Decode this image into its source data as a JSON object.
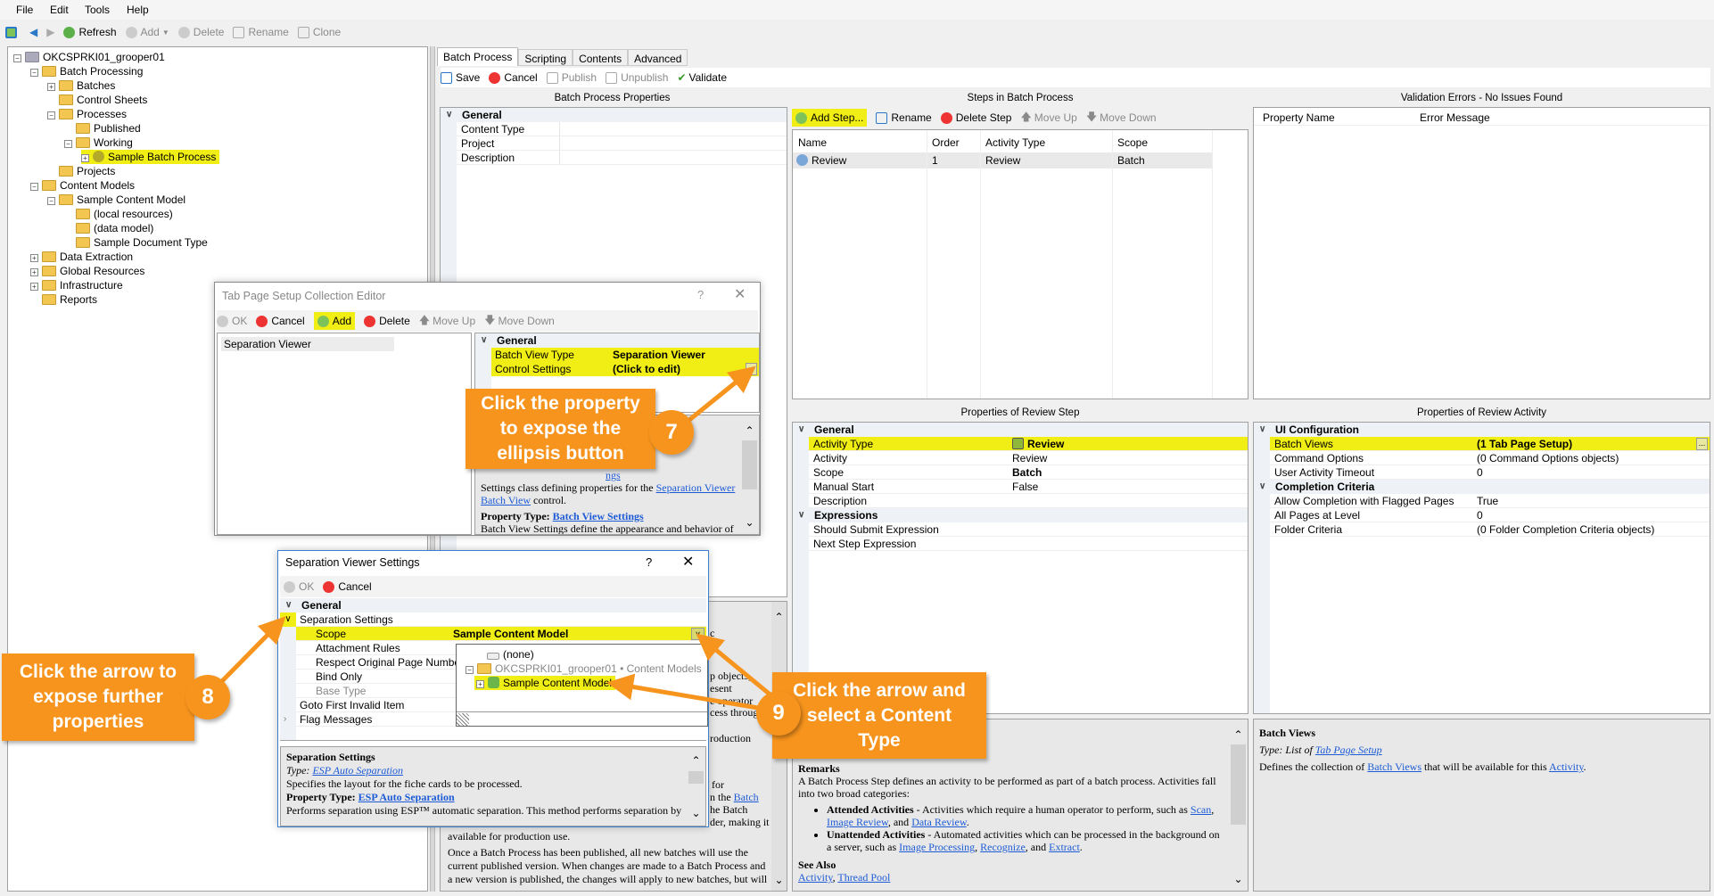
{
  "menu": [
    "File",
    "Edit",
    "Tools",
    "Help"
  ],
  "main_toolbar": {
    "refresh": "Refresh",
    "add": "Add",
    "delete": "Delete",
    "rename": "Rename",
    "clone": "Clone"
  },
  "tree": [
    {
      "label": "OKCSPRKI01_grooper01",
      "level": 0,
      "toggle": "-"
    },
    {
      "label": "Batch Processing",
      "level": 1,
      "toggle": "-"
    },
    {
      "label": "Batches",
      "level": 2,
      "toggle": "+"
    },
    {
      "label": "Control Sheets",
      "level": 2,
      "toggle": ""
    },
    {
      "label": "Processes",
      "level": 2,
      "toggle": "-"
    },
    {
      "label": "Published",
      "level": 3,
      "toggle": ""
    },
    {
      "label": "Working",
      "level": 3,
      "toggle": "-"
    },
    {
      "label": "Sample Batch Process",
      "level": 4,
      "toggle": "+",
      "selected": true
    },
    {
      "label": "Projects",
      "level": 2,
      "toggle": ""
    },
    {
      "label": "Content Models",
      "level": 1,
      "toggle": "-"
    },
    {
      "label": "Sample Content Model",
      "level": 2,
      "toggle": "-"
    },
    {
      "label": "(local resources)",
      "level": 3,
      "toggle": ""
    },
    {
      "label": "(data model)",
      "level": 3,
      "toggle": ""
    },
    {
      "label": "Sample Document Type",
      "level": 3,
      "toggle": ""
    },
    {
      "label": "Data Extraction",
      "level": 1,
      "toggle": "+"
    },
    {
      "label": "Global Resources",
      "level": 1,
      "toggle": "+"
    },
    {
      "label": "Infrastructure",
      "level": 1,
      "toggle": "+"
    },
    {
      "label": "Reports",
      "level": 1,
      "toggle": ""
    }
  ],
  "tabs": [
    "Batch Process",
    "Scripting",
    "Contents",
    "Advanced"
  ],
  "editor_toolbar": {
    "save": "Save",
    "cancel": "Cancel",
    "publish": "Publish",
    "unpublish": "Unpublish",
    "validate": "Validate"
  },
  "batch_props": {
    "title": "Batch Process Properties",
    "group": "General",
    "rows": [
      {
        "name": "Content Type",
        "value": ""
      },
      {
        "name": "Project",
        "value": ""
      },
      {
        "name": "Description",
        "value": ""
      }
    ]
  },
  "steps": {
    "title": "Steps in Batch Process",
    "toolbar": {
      "add": "Add Step...",
      "rename": "Rename",
      "delete": "Delete Step",
      "up": "Move Up",
      "down": "Move Down"
    },
    "columns": [
      "Name",
      "Order",
      "Activity Type",
      "Scope"
    ],
    "rows": [
      {
        "name": "Review",
        "order": "1",
        "type": "Review",
        "scope": "Batch"
      }
    ]
  },
  "validation": {
    "title": "Validation Errors - No Issues Found",
    "columns": [
      "Property Name",
      "Error Message"
    ]
  },
  "step_props": {
    "title": "Properties of Review Step",
    "group1": "General",
    "rows1": [
      {
        "name": "Activity Type",
        "value": "Review"
      },
      {
        "name": "Activity",
        "value": "Review"
      },
      {
        "name": "Scope",
        "value": "Batch"
      },
      {
        "name": "Manual Start",
        "value": "False"
      },
      {
        "name": "Description",
        "value": ""
      }
    ],
    "group2": "Expressions",
    "rows2": [
      {
        "name": "Should Submit Expression",
        "value": ""
      },
      {
        "name": "Next Step Expression",
        "value": ""
      }
    ]
  },
  "activity_props": {
    "title": "Properties of Review Activity",
    "group1": "UI Configuration",
    "rows1": [
      {
        "name": "Batch Views",
        "value": "(1 Tab Page Setup)"
      },
      {
        "name": "Command Options",
        "value": "(0 Command Options objects)"
      },
      {
        "name": "User Activity Timeout",
        "value": "0"
      }
    ],
    "group2": "Completion Criteria",
    "rows2": [
      {
        "name": "Allow Completion with Flagged Pages",
        "value": "True"
      },
      {
        "name": "All Pages at Level",
        "value": "0"
      },
      {
        "name": "Folder Criteria",
        "value": "(0 Folder Completion Criteria objects)"
      }
    ]
  },
  "step_help": {
    "remarks": "Remarks",
    "intro": "A Batch Process Step defines an activity to be performed as part of a batch process. Activities fall into two broad categories:",
    "b1_title": "Attended Activities",
    "b1_text": " - Activities which require a human operator to perform, such as ",
    "b1_links": [
      "Scan",
      "Image Review",
      "Data Review"
    ],
    "b2_title": "Unattended Activities",
    "b2_text": " - Automated activities which can be processed in the background on a server, such as ",
    "b2_links": [
      "Image Processing",
      "Recognize",
      "Extract"
    ],
    "and": ", and ",
    "see_also": "See Also",
    "see_links": [
      "Activity",
      "Thread Pool"
    ]
  },
  "activity_help": {
    "title": "Batch Views",
    "type_prefix": "Type: List of ",
    "type_link": "Tab Page Setup",
    "desc1": "Defines the collection of ",
    "desc_link1": "Batch Views",
    "desc2": " that will be available for this ",
    "desc_link2": "Activity",
    "desc3": "."
  },
  "batch_help_fragments": {
    "f1": "c",
    "f2": "p objects,",
    "f3": "esent",
    "f4": "e operator",
    "f5": "cess through",
    "f6": "roduction",
    "f7": "for",
    "f8": "n the ",
    "f8_link": "Batch",
    "f9": "he Batch",
    "f10": "der, making it",
    "p1": "available for production use.",
    "p2": "Once a Batch Process has been published, all new batches will use the current published version. When changes are made to a Batch Process and a new version is published, the changes will apply to new batches, but will"
  },
  "tab_dialog": {
    "title": "Tab Page Setup Collection Editor",
    "help_btn": "?",
    "toolbar": {
      "ok": "OK",
      "cancel": "Cancel",
      "add": "Add",
      "delete": "Delete",
      "up": "Move Up",
      "down": "Move Down"
    },
    "list": [
      "Separation Viewer"
    ],
    "group": "General",
    "rows": [
      {
        "name": "Batch View Type",
        "value": "Separation Viewer"
      },
      {
        "name": "Control Settings",
        "value": "(Click to edit)"
      }
    ],
    "ellipsis": "...",
    "help_frag": "ngs",
    "help_line1": "Settings class defining properties for the ",
    "help_link1": "Separation Viewer Batch View",
    "help_line1b": " control.",
    "help_prop_label": "Property Type: ",
    "help_prop_link": "Batch View Settings",
    "help_line2": "Batch View Settings define the appearance and behavior of"
  },
  "sep_dialog": {
    "title": "Separation Viewer Settings",
    "help_btn": "?",
    "toolbar": {
      "ok": "OK",
      "cancel": "Cancel"
    },
    "group": "General",
    "rows": [
      {
        "name": "Separation Settings",
        "value": "",
        "level": 0
      },
      {
        "name": "Scope",
        "value": "Sample Content Model",
        "level": 1
      },
      {
        "name": "Attachment Rules",
        "value": "",
        "level": 1
      },
      {
        "name": "Respect Original Page Numbers",
        "value": "",
        "level": 1
      },
      {
        "name": "Bind Only",
        "value": "",
        "level": 1
      },
      {
        "name": "Base Type",
        "value": "",
        "level": 1
      },
      {
        "name": "Goto First Invalid Item",
        "value": "",
        "level": 0
      },
      {
        "name": "Flag Messages",
        "value": "",
        "level": 0
      }
    ],
    "dropdown": {
      "none": "(none)",
      "root": "OKCSPRKI01_grooper01 • Content Models",
      "item": "Sample Content Model"
    },
    "help_title": "Separation Settings",
    "help_type_prefix": "Type: ",
    "help_type_link": "ESP Auto Separation",
    "help_desc": "Specifies the layout for the fiche cards to be processed.",
    "help_prop_label": "Property Type: ",
    "help_prop_link": "ESP Auto Separation",
    "help_line": "Performs separation using ESP™ automatic separation. This method performs separation by"
  },
  "callouts": [
    {
      "number": "7",
      "text": "Click the property to expose the ellipsis button"
    },
    {
      "number": "8",
      "text": "Click the arrow to expose further properties"
    },
    {
      "number": "9",
      "text": "Click the arrow and select a Content Type"
    }
  ],
  "colors": {
    "highlight": "#f0ee14",
    "callout": "#f7941d",
    "link": "#1d5bd6"
  }
}
